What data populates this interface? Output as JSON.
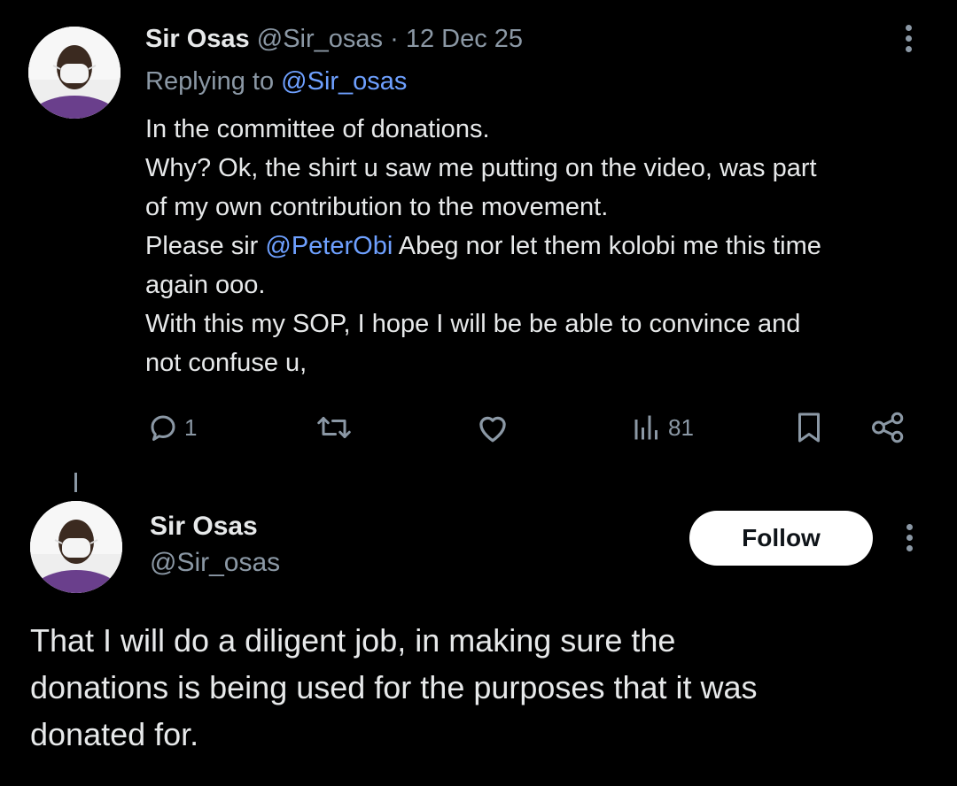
{
  "tweet1": {
    "author_name": "Sir Osas",
    "author_handle": "@Sir_osas",
    "separator": "·",
    "date": "12 Dec 25",
    "replying_label": "Replying to",
    "replying_handle": "@Sir_osas",
    "body": {
      "line1": "In the committee of donations.",
      "line2": "Why? Ok, the shirt u saw me putting on the video, was part",
      "line3": "of my own contribution to the movement.",
      "line4_pre": "Please sir ",
      "line4_mention": "@PeterObi",
      "line4_post": " Abeg nor let them kolobi me this time",
      "line5": "again ooo.",
      "line6": "With this my SOP, I hope I will be be able to convince  and",
      "line7": "not confuse u,"
    },
    "actions": {
      "reply_count": "1",
      "retweet_count": "",
      "like_count": "",
      "views_count": "81"
    }
  },
  "tweet2": {
    "author_name": "Sir Osas",
    "author_handle": "@Sir_osas",
    "follow_label": "Follow",
    "body": {
      "line1": "That I will do a diligent job, in making sure the",
      "line2": "donations is being used for the purposes that it was",
      "line3": "donated for."
    }
  },
  "icons": {
    "reply": "reply-icon",
    "retweet": "retweet-icon",
    "like": "heart-icon",
    "views": "views-icon",
    "bookmark": "bookmark-icon",
    "share": "share-icon",
    "more": "more-vertical-icon"
  },
  "colors": {
    "background": "#000000",
    "text": "#e7e9ea",
    "muted": "#8b98a5",
    "link": "#6ea0ff",
    "follow_bg": "#ffffff"
  }
}
